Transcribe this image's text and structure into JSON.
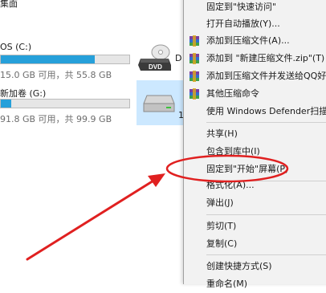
{
  "explorer": {
    "partial_title": "集面",
    "drives": [
      {
        "name": "OS (C:)",
        "space": "15.0 GB 可用，共 55.8 GB",
        "used_fraction": 0.73
      },
      {
        "name": "新加卷 (G:)",
        "space": "91.8 GB 可用，共 99.9 GB",
        "used_fraction": 0.08
      }
    ],
    "dvd_label": "DVD",
    "dvd_letter": "D",
    "selected_partial": "1"
  },
  "context_menu": {
    "items": [
      {
        "label": "固定到\"快速访问\"",
        "icon": ""
      },
      {
        "label": "打开自动播放(Y)...",
        "icon": ""
      },
      {
        "label": "添加到压缩文件(A)...",
        "icon": "winrar-icon"
      },
      {
        "label": "添加到 \"新建压缩文件.zip\"(T)",
        "icon": "winrar-icon"
      },
      {
        "label": "添加到压缩文件并发送给QQ好友",
        "icon": "winrar-icon"
      },
      {
        "label": "其他压缩命令",
        "icon": "winrar-icon"
      },
      {
        "label": "使用 Windows Defender扫描...",
        "icon": ""
      },
      {
        "label": "共享(H)",
        "icon": ""
      },
      {
        "label": "包含到库中(I)",
        "icon": ""
      },
      {
        "label": "固定到\"开始\"屏幕(P)",
        "icon": ""
      },
      {
        "label": "格式化(A)...",
        "icon": ""
      },
      {
        "label": "弹出(J)",
        "icon": ""
      },
      {
        "label": "剪切(T)",
        "icon": ""
      },
      {
        "label": "复制(C)",
        "icon": ""
      },
      {
        "label": "创建快捷方式(S)",
        "icon": ""
      },
      {
        "label": "重命名(M)",
        "icon": ""
      }
    ]
  },
  "annotation": {
    "color": "#e02020"
  }
}
